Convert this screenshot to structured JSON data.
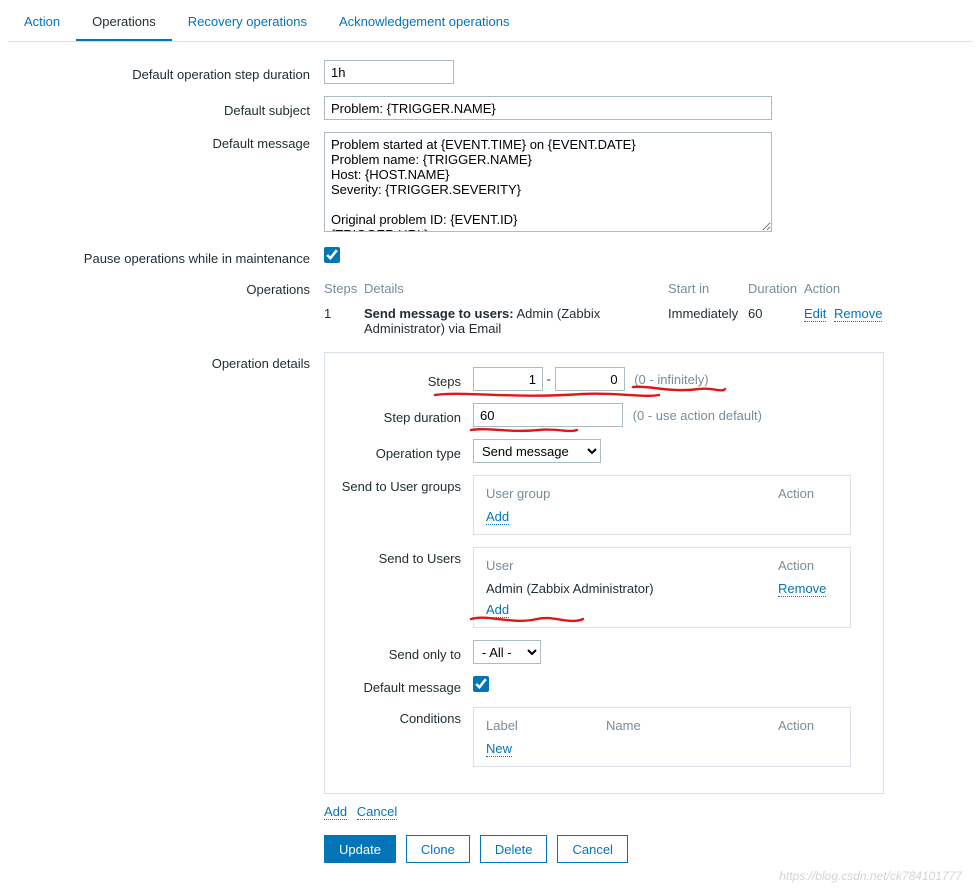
{
  "tabs": {
    "action": "Action",
    "operations": "Operations",
    "recovery": "Recovery operations",
    "ack": "Acknowledgement operations"
  },
  "labels": {
    "default_step_duration": "Default operation step duration",
    "default_subject": "Default subject",
    "default_message": "Default message",
    "pause_maintenance": "Pause operations while in maintenance",
    "operations": "Operations",
    "operation_details": "Operation details"
  },
  "fields": {
    "step_duration": "1h",
    "subject": "Problem: {TRIGGER.NAME}",
    "message": "Problem started at {EVENT.TIME} on {EVENT.DATE}\nProblem name: {TRIGGER.NAME}\nHost: {HOST.NAME}\nSeverity: {TRIGGER.SEVERITY}\n\nOriginal problem ID: {EVENT.ID}\n{TRIGGER.URL}"
  },
  "ops_table": {
    "headers": {
      "steps": "Steps",
      "details": "Details",
      "startin": "Start in",
      "duration": "Duration",
      "action": "Action"
    },
    "row": {
      "steps": "1",
      "details_prefix": "Send message to users:",
      "details_rest": " Admin (Zabbix Administrator) via Email",
      "startin": "Immediately",
      "duration": "60",
      "edit": "Edit",
      "remove": "Remove"
    }
  },
  "detail": {
    "steps_label": "Steps",
    "steps_from": "1",
    "steps_to": "0",
    "steps_hint": "(0 - infinitely)",
    "step_duration_label": "Step duration",
    "step_duration_value": "60",
    "step_duration_hint": "(0 - use action default)",
    "op_type_label": "Operation type",
    "op_type_value": "Send message",
    "send_user_groups_label": "Send to User groups",
    "user_group_header": "User group",
    "action_header": "Action",
    "add": "Add",
    "send_users_label": "Send to Users",
    "user_header": "User",
    "user_value": "Admin (Zabbix Administrator)",
    "remove": "Remove",
    "send_only_label": "Send only to",
    "send_only_value": "- All -",
    "default_msg_label": "Default message",
    "conditions_label": "Conditions",
    "cond_label": "Label",
    "cond_name": "Name",
    "new": "New",
    "cancel": "Cancel"
  },
  "buttons": {
    "update": "Update",
    "clone": "Clone",
    "delete": "Delete",
    "cancel": "Cancel"
  },
  "watermark": "https://blog.csdn.net/ck784101777"
}
